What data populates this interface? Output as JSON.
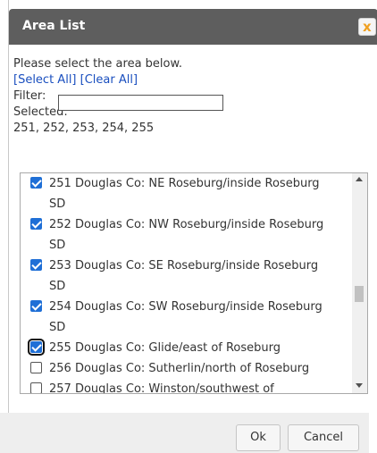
{
  "dialog": {
    "title": "Area List",
    "close_label": "x",
    "instruction": "Please select the area below.",
    "select_all": "[Select All]",
    "clear_all": "[Clear All]",
    "filter_label": "Filter:",
    "filter_value": "",
    "selected_label": "Selected:",
    "selected_values": "251, 252, 253, 254, 255",
    "ok_label": "Ok",
    "cancel_label": "Cancel"
  },
  "areas": [
    {
      "line1": "251 Douglas Co: NE Roseburg/inside Roseburg",
      "line2": "SD",
      "checked": true
    },
    {
      "line1": "252 Douglas Co: NW Roseburg/inside Roseburg",
      "line2": "SD",
      "checked": true
    },
    {
      "line1": "253 Douglas Co: SE Roseburg/inside Roseburg",
      "line2": "SD",
      "checked": true
    },
    {
      "line1": "254 Douglas Co: SW Roseburg/inside Roseburg",
      "line2": "SD",
      "checked": true
    },
    {
      "line1": "255 Douglas Co: Glide/east of Roseburg",
      "line2": "",
      "checked": true
    },
    {
      "line1": "256 Douglas Co: Sutherlin/north of Roseburg",
      "line2": "",
      "checked": false
    },
    {
      "line1": "257 Douglas Co: Winston/southwest of",
      "line2": "",
      "checked": false
    }
  ]
}
